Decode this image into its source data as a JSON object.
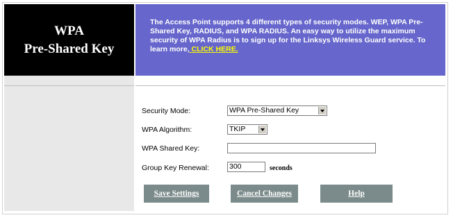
{
  "header": {
    "title_line1": "WPA",
    "title_line2": "Pre-Shared Key",
    "banner_text": "The Access Point supports 4 different types of security modes. WEP, WPA Pre-Shared Key, RADIUS, and WPA RADIUS. An easy way to utilize the maximum security of WPA Radius is to sign up for the Linksys Wireless Guard service. To learn more,",
    "banner_link": " CLICK HERE."
  },
  "form": {
    "security_mode_label": "Security Mode:",
    "security_mode_value": "WPA Pre-Shared Key",
    "wpa_algorithm_label": "WPA Algorithm:",
    "wpa_algorithm_value": "TKIP",
    "wpa_shared_key_label": "WPA Shared Key:",
    "wpa_shared_key_value": "",
    "group_key_renewal_label": "Group Key Renewal:",
    "group_key_renewal_value": "300",
    "group_key_renewal_unit": "seconds"
  },
  "buttons": {
    "save": "Save Settings",
    "cancel": "Cancel Changes",
    "help": "Help"
  },
  "colors": {
    "banner_bg": "#6666cc",
    "title_bg": "#000000",
    "link": "#ffff00",
    "button_bg": "#7b8a8a"
  }
}
